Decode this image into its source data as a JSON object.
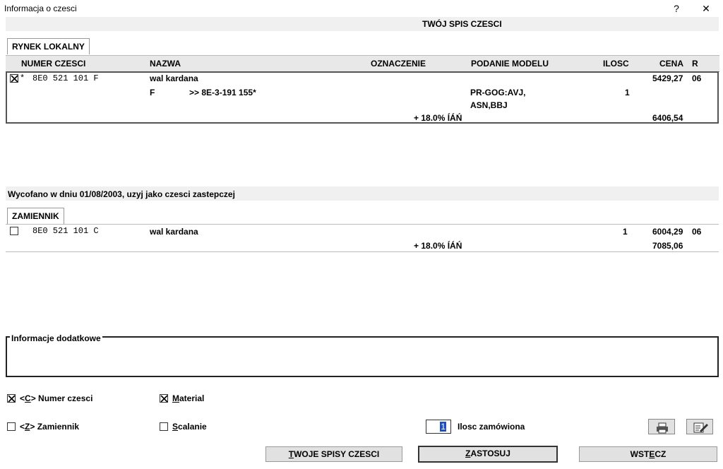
{
  "window": {
    "title": "Informacja o czesci",
    "help_label": "?",
    "close_label": "✕"
  },
  "header": {
    "title": "TWÓJ SPIS CZESCI"
  },
  "local_tab": {
    "label": "RYNEK LOKALNY"
  },
  "columns": {
    "part_number": "NUMER CZESCI",
    "name": "NAZWA",
    "designation": "OZNACZENIE",
    "model": "PODANIE MODELU",
    "qty": "ILOSC",
    "price": "CENA",
    "r": "R"
  },
  "main_part": {
    "star": "*",
    "number": "8E0 521 101 F",
    "name": "wal kardana",
    "sub_code": "F",
    "sub_ref": ">> 8E-3-191 155*",
    "model_line1": "PR-GOG:AVJ,",
    "model_line2": "ASN,BBJ",
    "qty": "1",
    "price": "5429,27",
    "r": "06",
    "vat_label": "+ 18.0% ÍÁŃ",
    "price_gross": "6406,54"
  },
  "withdrawn_notice": "Wycofano w dniu 01/08/2003, uzyj jako czesci zastepczej",
  "replacement_tab": {
    "label": "ZAMIENNIK"
  },
  "replacement_part": {
    "number": "8E0 521 101 C",
    "name": "wal kardana",
    "qty": "1",
    "price": "6004,29",
    "r": "06",
    "vat_label": "+ 18.0% ÍÁŃ",
    "price_gross": "7085,06"
  },
  "info": {
    "label": "Informacje dodatkowe"
  },
  "options": {
    "part_number": {
      "label_pre": "<",
      "label_key": "C",
      "label_post": "> Numer czesci",
      "checked": true
    },
    "replacement": {
      "label_pre": "<",
      "label_key": "Z",
      "label_post": "> Zamiennik",
      "checked": false
    },
    "material": {
      "label_key": "M",
      "label_post": "aterial",
      "checked": true
    },
    "merge": {
      "label_key": "S",
      "label_post": "calanie",
      "checked": false
    }
  },
  "order_qty": {
    "value": "1",
    "label": "Ilosc zamówiona"
  },
  "buttons": {
    "lists_pre": "",
    "lists_key": "T",
    "lists_post": "WOJE SPISY CZESCI",
    "apply_pre": "",
    "apply_key": "Z",
    "apply_post": "ASTOSUJ",
    "back_pre": "WST",
    "back_key": "E",
    "back_post": "CZ"
  },
  "icons": {
    "print": "printer-icon",
    "edit": "edit-icon"
  }
}
